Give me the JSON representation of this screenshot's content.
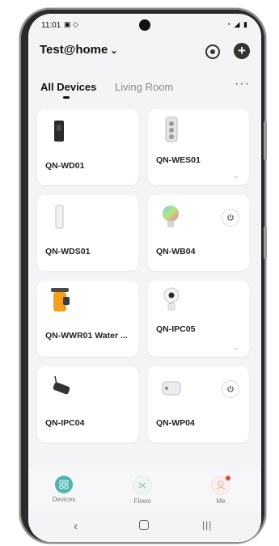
{
  "status_bar": {
    "time": "11:01",
    "left_icons": "▣ ◇",
    "right_icons": "◔ ◢ ▮"
  },
  "header": {
    "home_name": "Test@home",
    "chevron": "⌄"
  },
  "tabs": [
    {
      "label": "All Devices",
      "active": true
    },
    {
      "label": "Living Room",
      "active": false
    }
  ],
  "more_label": "···",
  "devices": [
    {
      "name": "QN-WD01",
      "icon": "door-sensor-icon",
      "has_power": false,
      "has_expand": false
    },
    {
      "name": "QN-WES01",
      "icon": "power-strip-icon",
      "has_power": false,
      "has_expand": true
    },
    {
      "name": "QN-WDS01",
      "icon": "window-sensor-icon",
      "has_power": false,
      "has_expand": false
    },
    {
      "name": "QN-WB04",
      "icon": "smart-bulb-icon",
      "has_power": true,
      "has_expand": false
    },
    {
      "name": "QN-WWR01 Water ...",
      "icon": "water-valve-icon",
      "has_power": false,
      "has_expand": false
    },
    {
      "name": "QN-IPC05",
      "icon": "indoor-camera-icon",
      "has_power": false,
      "has_expand": true
    },
    {
      "name": "QN-IPC04",
      "icon": "outdoor-camera-icon",
      "has_power": false,
      "has_expand": false
    },
    {
      "name": "QN-WP04",
      "icon": "smart-plug-icon",
      "has_power": true,
      "has_expand": false
    }
  ],
  "bottom_nav": [
    {
      "label": "Devices",
      "active": true
    },
    {
      "label": "Flows",
      "active": false
    },
    {
      "label": "Me",
      "active": false,
      "badge": true
    }
  ],
  "colors": {
    "accent": "#4fb3b0",
    "background": "#f4f4f6",
    "card": "#ffffff",
    "badge": "#e8453c"
  }
}
